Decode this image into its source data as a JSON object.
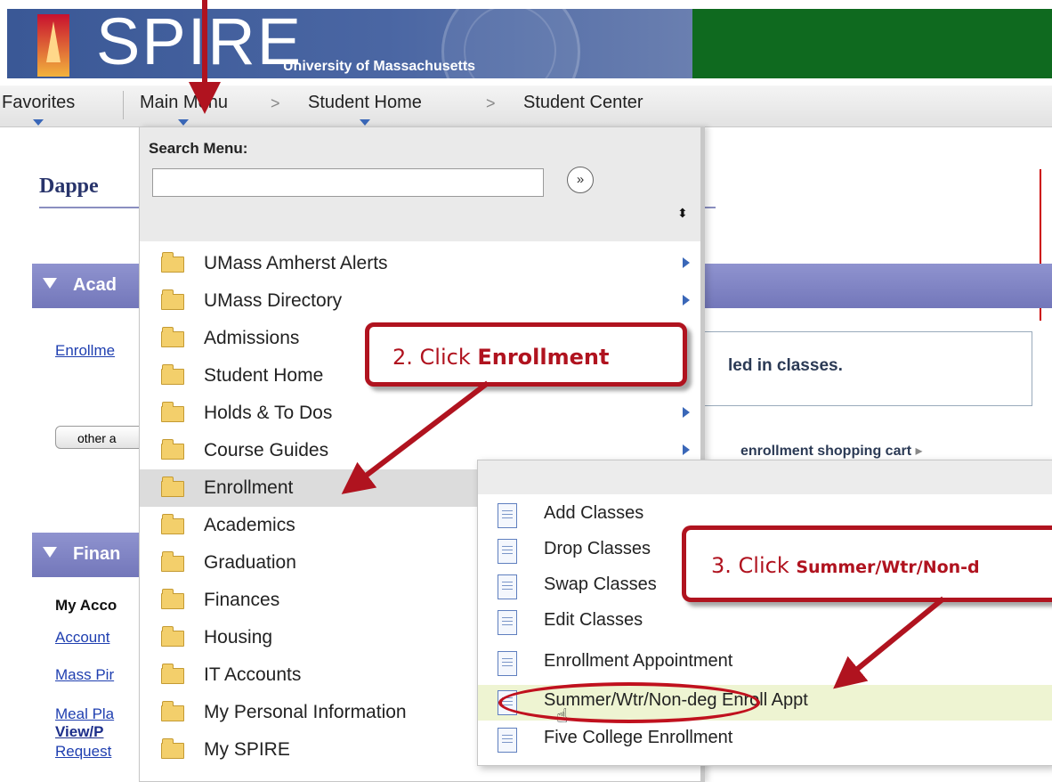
{
  "header": {
    "logo_text": "SPIRE",
    "logo_subtitle": "University of Massachusetts"
  },
  "nav": {
    "items": [
      "Favorites",
      "Main Menu",
      "Student Home",
      "Student Center"
    ],
    "separator": ">"
  },
  "page": {
    "title_partial": "Dappe",
    "sections": [
      "Acad",
      "Finan"
    ],
    "left_links": [
      "Enrollme",
      "Account",
      "Mass Pir",
      "Meal Pla",
      "View/P",
      "Request"
    ],
    "my_account_partial": "My Acco",
    "other_button": "other a",
    "info_text": "led in classes.",
    "cart_link": "enrollment shopping cart",
    "cart_arrow": "▸"
  },
  "menu": {
    "search_label": "Search Menu:",
    "search_value": "",
    "search_go_icon": "»",
    "sort_icon": "⬍",
    "items": [
      {
        "label": "UMass Amherst Alerts",
        "has_submenu": true
      },
      {
        "label": "UMass Directory",
        "has_submenu": true
      },
      {
        "label": "Admissions",
        "has_submenu": false
      },
      {
        "label": "Student Home",
        "has_submenu": false
      },
      {
        "label": "Holds & To Dos",
        "has_submenu": true
      },
      {
        "label": "Course Guides",
        "has_submenu": true
      },
      {
        "label": "Enrollment",
        "has_submenu": false,
        "active": true
      },
      {
        "label": "Academics",
        "has_submenu": false
      },
      {
        "label": "Graduation",
        "has_submenu": false
      },
      {
        "label": "Finances",
        "has_submenu": false
      },
      {
        "label": "Housing",
        "has_submenu": false
      },
      {
        "label": "IT Accounts",
        "has_submenu": false
      },
      {
        "label": "My Personal Information",
        "has_submenu": false
      },
      {
        "label": "My SPIRE",
        "has_submenu": false
      }
    ]
  },
  "submenu": {
    "items": [
      {
        "label": "Add Classes"
      },
      {
        "label": "Drop Classes"
      },
      {
        "label": "Swap Classes"
      },
      {
        "label": "Edit Classes"
      },
      {
        "label": "Enrollment Appointment"
      },
      {
        "label": "Summer/Wtr/Non-deg Enroll Appt",
        "hover": true
      },
      {
        "label": "Five College Enrollment"
      }
    ]
  },
  "annotations": {
    "step2_prefix": "2.  Click ",
    "step2_bold": "Enrollment",
    "step3_prefix": "3.  Click ",
    "step3_bold": "Summer/Wtr/Non-d",
    "color": "#b0131f"
  },
  "colors": {
    "header_green": "#0f6a1f",
    "header_blue": "#3a5896",
    "section_purple": "#8086c4",
    "link_blue": "#1f3fb0",
    "folder_yellow": "#f3cf6b",
    "hover_row": "#eef4d2"
  }
}
